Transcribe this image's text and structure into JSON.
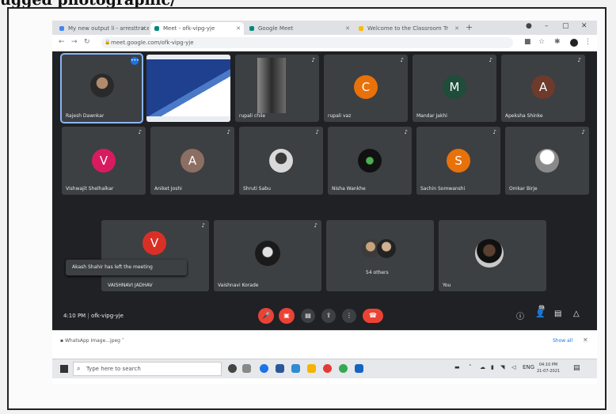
{
  "caption": "ugged photographic/",
  "browser": {
    "tabs": [
      {
        "label": "My new output li - arresttraceable",
        "active": false,
        "fav": "#4285f4"
      },
      {
        "label": "Meet - ofk-vipg-yje",
        "active": true,
        "fav": "#00897b"
      },
      {
        "label": "Google Meet",
        "active": false,
        "fav": "#00897b"
      },
      {
        "label": "Welcome to the Classroom Tr",
        "active": false,
        "fav": "#fbbc04"
      }
    ],
    "new_tab": "+",
    "url": "meet.google.com/ofk-vipg-yje"
  },
  "meeting": {
    "tiles": [
      {
        "name": "Rajesh Dawnkar",
        "initial": "",
        "color": "",
        "photo": true,
        "highlight": true
      },
      {
        "name": "",
        "initial": "",
        "color": "",
        "photo": false,
        "screen": true
      },
      {
        "name": "rupali chile",
        "initial": "",
        "color": "",
        "photo": false,
        "door": true
      },
      {
        "name": "rupali vaz",
        "initial": "C",
        "color": "#e8710a"
      },
      {
        "name": "Mandar Jakhi",
        "initial": "M",
        "color": "#1e4d3a"
      },
      {
        "name": "Apeksha Shinke",
        "initial": "A",
        "color": "#6d3a2c"
      },
      {
        "name": "Vishwajit Shelhalkar",
        "initial": "V",
        "color": "#d81b60"
      },
      {
        "name": "Aniket Joshi",
        "initial": "A",
        "color": "#8d6e63"
      },
      {
        "name": "Shruti Sabu",
        "initial": "",
        "color": "",
        "photo": true
      },
      {
        "name": "Nisha Wankhe",
        "initial": "",
        "color": "",
        "photo": true,
        "dark": true
      },
      {
        "name": "Sachin Somwanshi",
        "initial": "S",
        "color": "#e8710a"
      },
      {
        "name": "Omkar Birje",
        "initial": "",
        "color": "",
        "photo": true
      },
      {
        "name": "VAISHNAVI JADHAV",
        "initial": "V",
        "color": "#d93025"
      },
      {
        "name": "Vaishnavi Korade",
        "initial": "",
        "color": "",
        "photo": true
      },
      {
        "name": "54 others",
        "initial": "",
        "color": "",
        "photo": true,
        "group": true
      },
      {
        "name": "You",
        "initial": "",
        "color": "",
        "photo": true
      }
    ],
    "toast": "Akash Shahir has left the meeting",
    "time": "4:10 PM",
    "meeting_code": "ofk-vipg-yje",
    "people_count": "59"
  },
  "downloads": {
    "item": "WhatsApp Image...jpeg",
    "show_all": "Show all"
  },
  "taskbar": {
    "search_placeholder": "Type here to search",
    "time": "04:10 PM",
    "date": "21-07-2021",
    "lang": "ENG"
  }
}
